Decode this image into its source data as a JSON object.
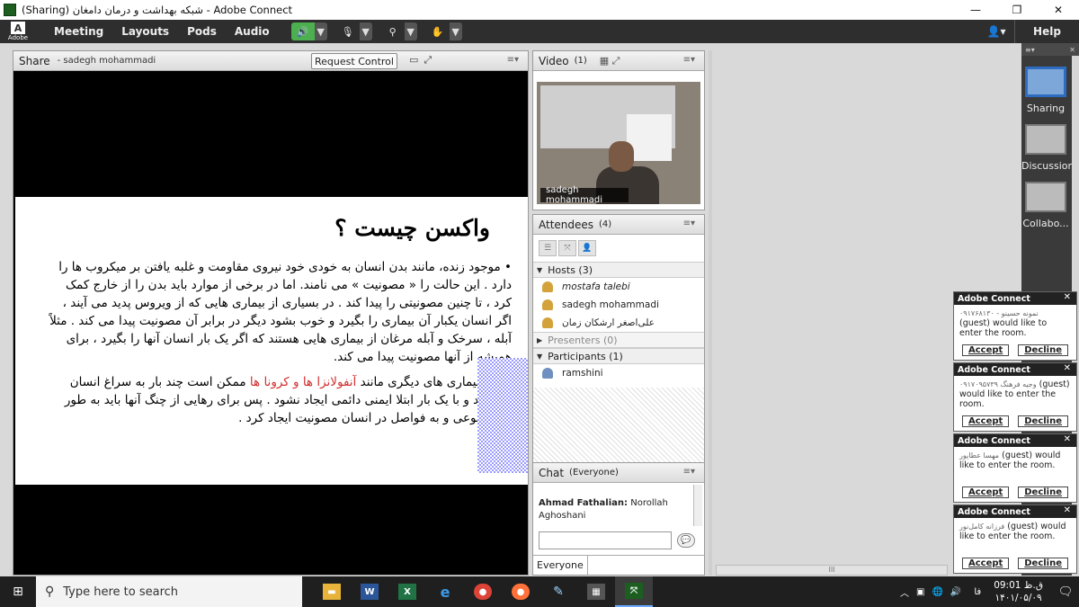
{
  "window": {
    "title": "(Sharing) شبکه بهداشت و درمان دامغان - Adobe Connect",
    "minimize": "—",
    "maximize": "❐",
    "close": "✕"
  },
  "menubar": {
    "logo_mark": "A",
    "logo_word": "Adobe",
    "items": [
      "Meeting",
      "Layouts",
      "Pods",
      "Audio"
    ],
    "help": "Help"
  },
  "share": {
    "title": "Share",
    "presenter": "- sadegh mohammadi",
    "request_control": "Request Control",
    "slide": {
      "heading": "واکسن چیست ؟",
      "paragraph1": "• موجود زنده، مانند بدن انسان به خودی خود نیروی مقاومت و غلبه یافتن بر میکروب ها را دارد . این حالت را « مصونیت » می نامند. اما در برخی از موارد باید بدن را از خارج کمک کرد ، تا چنین مصونیتی را پیدا کند . در بسیاری از بیماری هایی که از ویروس پدید می آیند ، اگر انسان یکبار آن بیماری را بگیرد و خوب بشود دیگر در برابر آن مصونیت پیدا می کند . مثلاً آبله ، سرخک و آبله مرغان از بیماری هایی هستند که اگر یک بار انسان آنها را بگیرد ، برای همیشه از آنها مصونیت پیدا می کند.",
      "paragraph2_a": "اما بیماری های دیگری مانند ",
      "paragraph2_red": "آنفولانزا ها و کرونا ها",
      "paragraph2_b": " ممکن است چند بار به سراغ انسان بیایند و با یک بار ابتلا ایمنی دائمی ایجاد نشود . پس برای رهایی از چنگ آنها باید به طور مصنوعی و به فواصل در انسان مصونیت ایجاد کرد ."
    }
  },
  "video": {
    "title": "Video",
    "count": "(1)",
    "speaker_name": "sadegh mohammadi"
  },
  "attendees": {
    "title": "Attendees",
    "count": "(4)",
    "hosts_label": "Hosts (3)",
    "hosts": [
      "mostafa talebi",
      "sadegh mohammadi",
      "علی‌اصغر ارشکان زمان"
    ],
    "presenters_label": "Presenters (0)",
    "participants_label": "Participants (1)",
    "participants": [
      "ramshini"
    ]
  },
  "chat": {
    "title": "Chat",
    "scope": "(Everyone)",
    "sender": "Ahmad Fathalian:",
    "message": "Norollah Aghoshani",
    "input_placeholder": "",
    "recipient": "Everyone"
  },
  "layouts": {
    "items": [
      "Sharing",
      "Discussion",
      "Collabo..."
    ],
    "active": "Sharing"
  },
  "notifications": [
    {
      "header": "Adobe Connect",
      "guest": "نمونه حسینو - ۰۹۱۷۶۸۱۳۰",
      "text": "(guest) would like to enter the room.",
      "accept": "Accept",
      "decline": "Decline"
    },
    {
      "header": "Adobe Connect",
      "guest": "۰۹۱۷۰۹۵۷۳۹ وجیه فرهنگ",
      "text": "(guest) would like to enter the room.",
      "accept": "Accept",
      "decline": "Decline"
    },
    {
      "header": "Adobe Connect",
      "guest": "مهسا عطاپور",
      "text": "(guest) would like to enter the room.",
      "accept": "Accept",
      "decline": "Decline"
    },
    {
      "header": "Adobe Connect",
      "guest": "فرزانه کامل‌نور",
      "text": "(guest) would like to enter the room.",
      "accept": "Accept",
      "decline": "Decline"
    }
  ],
  "taskbar": {
    "search_placeholder": "Type here to search",
    "language": "فا",
    "time": "09:01 ق.ظ",
    "date": "۱۴۰۱/۰۵/۰۹"
  },
  "colors": {
    "menubar_bg": "#2e2e2e",
    "speaker_active": "#4caf50",
    "highlight_red": "#d32f2f",
    "layout_active": "#2d6cc0"
  }
}
